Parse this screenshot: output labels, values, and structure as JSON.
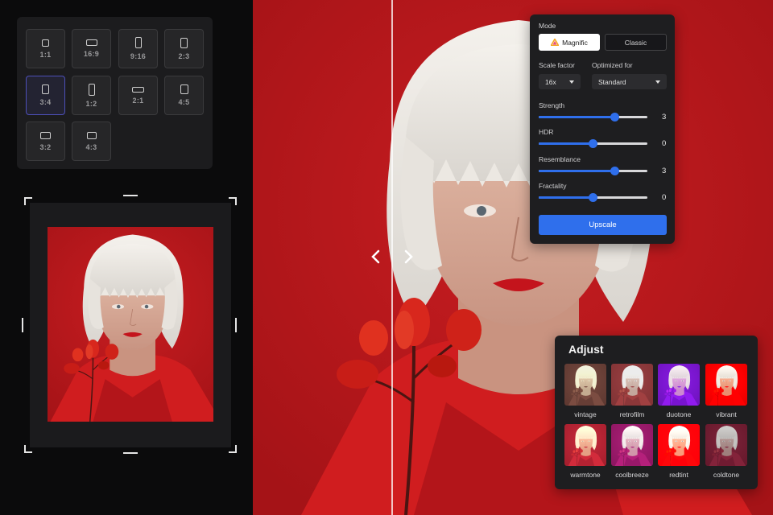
{
  "aspect_ratios": [
    "1:1",
    "16:9",
    "9:16",
    "2:3",
    "3:4",
    "1:2",
    "2:1",
    "4:5",
    "3:2",
    "4:3"
  ],
  "selected_ratio": "3:4",
  "upscale": {
    "mode_label": "Mode",
    "modes": [
      "Magnific",
      "Classic"
    ],
    "active_mode": "Magnific",
    "scale_factor_label": "Scale factor",
    "scale_factor_value": "16x",
    "optimized_for_label": "Optimized for",
    "optimized_for_value": "Standard",
    "sliders": [
      {
        "label": "Strength",
        "value": "3",
        "fraction": 0.7
      },
      {
        "label": "HDR",
        "value": "0",
        "fraction": 0.5
      },
      {
        "label": "Resemblance",
        "value": "3",
        "fraction": 0.7
      },
      {
        "label": "Fractality",
        "value": "0",
        "fraction": 0.5
      }
    ],
    "upscale_button": "Upscale"
  },
  "adjust": {
    "title": "Adjust",
    "filters": [
      "vintage",
      "retrofilm",
      "duotone",
      "vibrant",
      "warmtone",
      "coolbreeze",
      "redtint",
      "coldtone"
    ]
  },
  "colors": {
    "accent": "#2f6fec",
    "selected_ratio_border": "#4d4fb8",
    "photo_background": "#c41a1d"
  }
}
